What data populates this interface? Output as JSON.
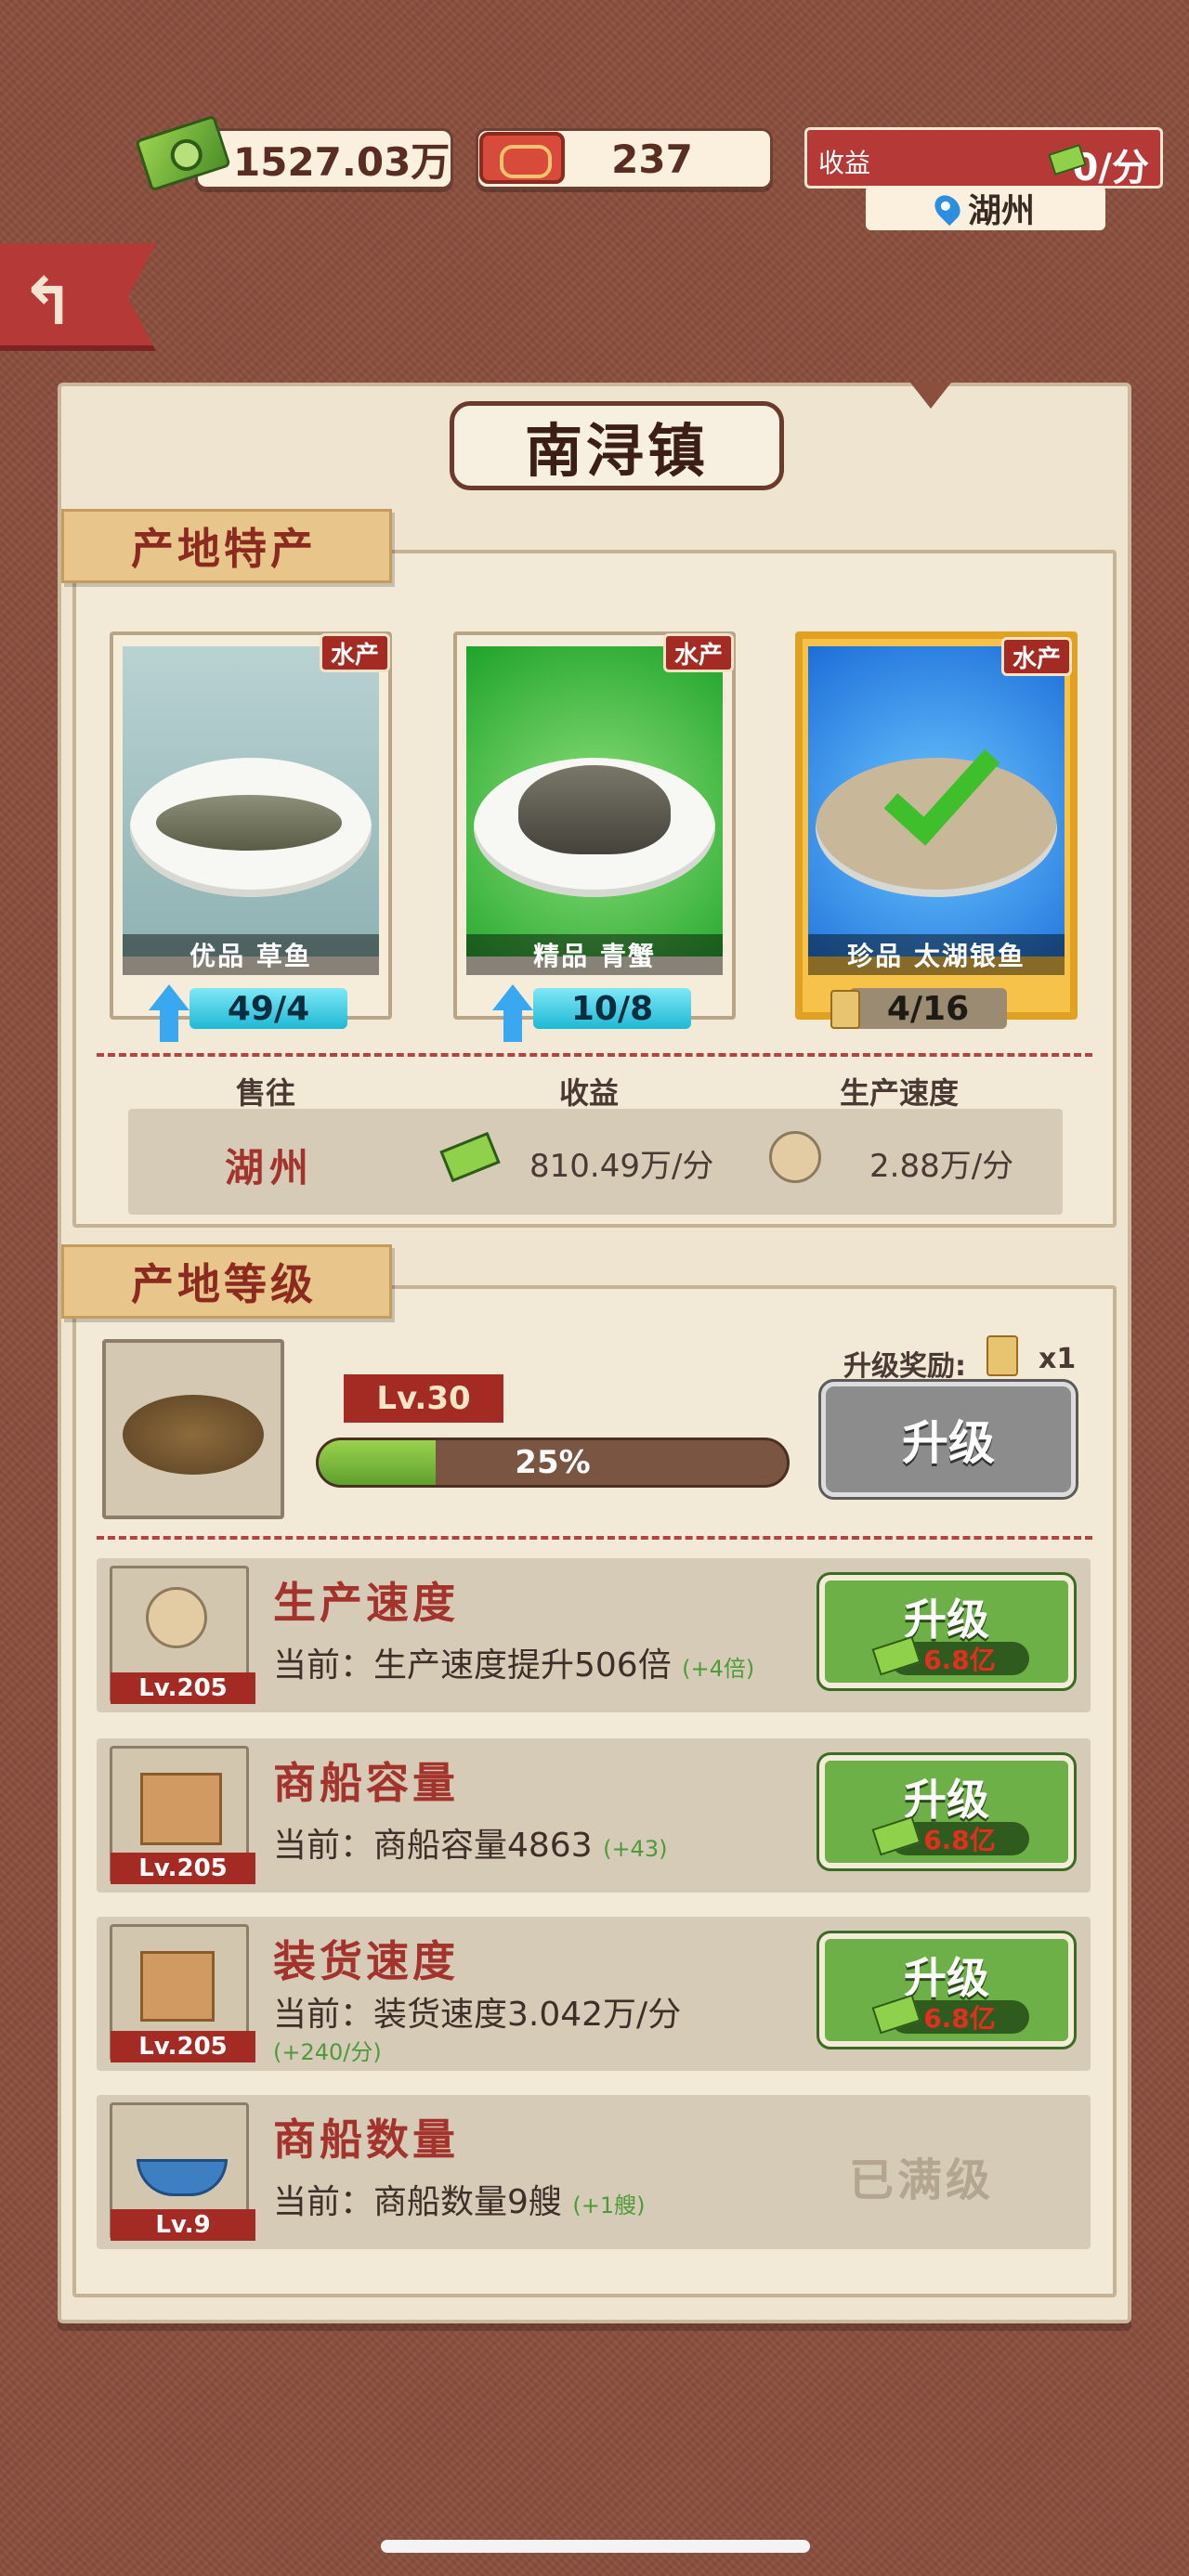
{
  "top_bar": {
    "money": "1527.03万",
    "tickets": "237",
    "income_label": "收益",
    "income_value": "0/分",
    "location": "湖州"
  },
  "panel": {
    "title": "南浔镇",
    "specialty_heading": "产地特产",
    "products": [
      {
        "badge": "水产",
        "name": "优品 草鱼",
        "count": "49/4",
        "bg": "#9fc0c0"
      },
      {
        "badge": "水产",
        "name": "精品 青蟹",
        "count": "10/8",
        "bg": "#33b23b"
      },
      {
        "badge": "水产",
        "name": "珍品 太湖银鱼",
        "count": "4/16",
        "bg": "#1c86e6"
      }
    ],
    "stats_labels": {
      "sell_to": "售往",
      "income": "收益",
      "speed": "生产速度"
    },
    "stats_values": {
      "city": "湖州",
      "income": "810.49万/分",
      "speed": "2.88万/分"
    },
    "level_heading": "产地等级",
    "level": "Lv.30",
    "progress_text": "25%",
    "progress": 0.25,
    "reward_label": "升级奖励:",
    "reward_count": "x1",
    "upgrade_label": "升级",
    "upgrades": [
      {
        "lv": "Lv.205",
        "title": "生产速度",
        "current": "当前：生产速度提升506倍",
        "inc": "(+4倍)",
        "button": "升级",
        "cost": "6.8亿"
      },
      {
        "lv": "Lv.205",
        "title": "商船容量",
        "current": "当前：商船容量4863",
        "inc": "(+43)",
        "button": "升级",
        "cost": "6.8亿"
      },
      {
        "lv": "Lv.205",
        "title": "装货速度",
        "current": "当前：装货速度3.042万/分",
        "inc": "(+240/分)",
        "button": "升级",
        "cost": "6.8亿"
      },
      {
        "lv": "Lv.9",
        "title": "商船数量",
        "current": "当前：商船数量9艘",
        "inc": "(+1艘)",
        "status": "已满级"
      }
    ]
  }
}
